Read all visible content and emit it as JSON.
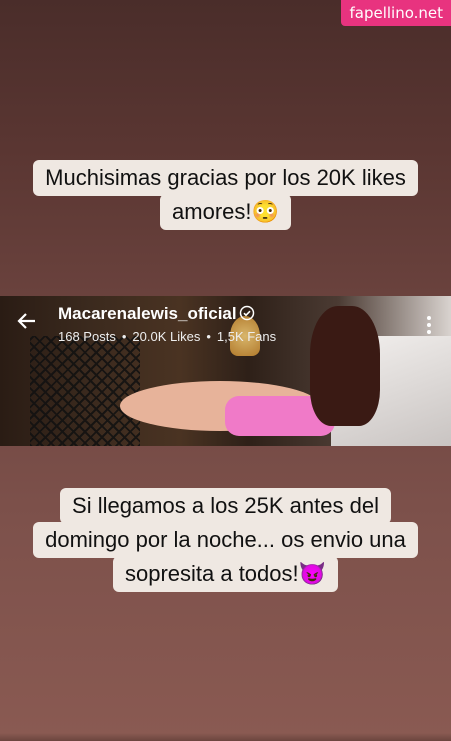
{
  "watermark": "fapellino.net",
  "caption_top": [
    "Muchisimas gracias por los 20K likes",
    "amores!😳"
  ],
  "profile": {
    "name": "Macarenalewis_oficial",
    "posts": "168 Posts",
    "likes": "20.0K Likes",
    "fans": "1,5K Fans"
  },
  "caption_bottom": [
    "Si llegamos a los 25K antes del",
    "domingo por la noche... os envio una",
    "sopresita a todos!😈"
  ],
  "icons": {
    "back": "arrow-left-icon",
    "verified": "verified-badge-icon",
    "more": "more-vertical-icon"
  },
  "colors": {
    "watermark_bg": "#e8337f",
    "caption_bg": "#efe8e2"
  }
}
